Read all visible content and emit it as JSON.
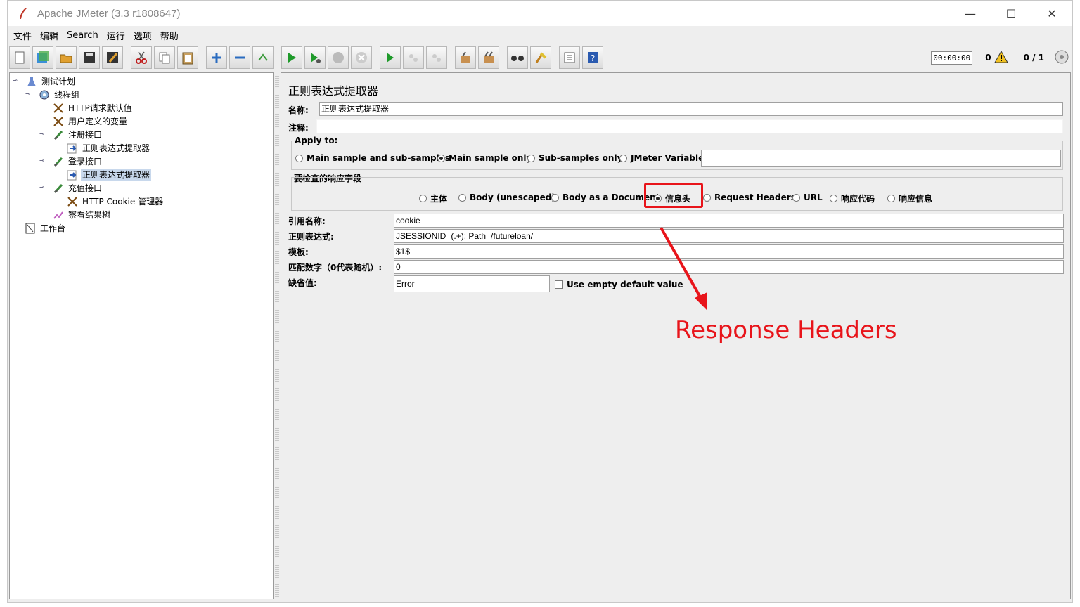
{
  "window": {
    "title": "Apache JMeter (3.3 r1808647)",
    "controls": {
      "minimize": "—",
      "maximize": "☐",
      "close": "✕"
    }
  },
  "menu": [
    "文件",
    "编辑",
    "Search",
    "运行",
    "选项",
    "帮助"
  ],
  "toolbar": {
    "timer": "00:00:00",
    "warning_count": "0",
    "threads": "0 / 1",
    "buttons": [
      "new-icon",
      "templates-icon",
      "open-icon",
      "save-icon",
      "save-as-icon",
      "cut-icon",
      "copy-icon",
      "paste-icon",
      "expand-icon",
      "collapse-icon",
      "toggle-icon",
      "start-icon",
      "start-no-pause-icon",
      "stop-icon",
      "shutdown-icon",
      "remote-start-icon",
      "remote-stop-icon",
      "remote-shutdown-icon",
      "clear-icon",
      "clear-all-icon",
      "search-icon",
      "reset-search-icon",
      "function-helper-icon",
      "help-icon"
    ]
  },
  "tree": [
    {
      "label": "测试计划",
      "icon": "test-plan-icon"
    },
    {
      "label": "线程组",
      "icon": "gear-icon"
    },
    {
      "label": "HTTP请求默认值",
      "icon": "config-icon"
    },
    {
      "label": "用户定义的变量",
      "icon": "config-icon"
    },
    {
      "label": "注册接口",
      "icon": "sampler-icon"
    },
    {
      "label": "正则表达式提取器",
      "icon": "extractor-icon"
    },
    {
      "label": "登录接口",
      "icon": "sampler-icon"
    },
    {
      "label": "正则表达式提取器",
      "icon": "extractor-icon"
    },
    {
      "label": "充值接口",
      "icon": "sampler-icon"
    },
    {
      "label": "HTTP Cookie 管理器",
      "icon": "config-icon"
    },
    {
      "label": "察看结果树",
      "icon": "listener-icon"
    },
    {
      "label": "工作台",
      "icon": "workbench-icon"
    }
  ],
  "editor": {
    "title": "正则表达式提取器",
    "name_label": "名称:",
    "name_value": "正则表达式提取器",
    "comment_label": "注释:",
    "apply_to": {
      "title": "Apply to:",
      "options": [
        "Main sample and sub-samples",
        "Main sample only",
        "Sub-samples only",
        "JMeter Variable"
      ],
      "selected": "Main sample only"
    },
    "field_to_check": {
      "title": "要检查的响应字段",
      "options": [
        "主体",
        "Body (unescaped)",
        "Body as a Document",
        "信息头",
        "Request Headers",
        "URL",
        "响应代码",
        "响应信息"
      ],
      "selected": "信息头"
    },
    "ref_name_label": "引用名称:",
    "ref_name_value": "cookie",
    "regex_label": "正则表达式:",
    "regex_value": "JSESSIONID=(.+); Path=/futureloan/",
    "template_label": "模板:",
    "template_value": "$1$",
    "match_no_label": "匹配数字（0代表随机）:",
    "match_no_value": "0",
    "default_label": "缺省值:",
    "default_value": "Error",
    "use_empty_label": "Use empty default value"
  },
  "annotation": {
    "text": "Response Headers",
    "color": "#e8141a"
  }
}
